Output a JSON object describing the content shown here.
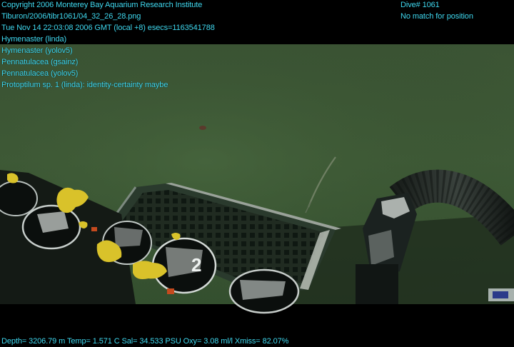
{
  "overlay": {
    "lines_left": [
      "Copyright 2006 Monterey Bay Aquarium Research Institute",
      "Tiburon/2006/tibr1061/04_32_26_28.png",
      "Tue Nov 14 22:03:08 2006 GMT (local +8)  esecs=1163541788",
      "Hymenaster (linda)",
      "Hymenaster (yolov5)",
      "Pennatulacea (gsainz)",
      "Pennatulacea (yolov5)",
      "Protoptilum sp. 1 (linda): identity-certainty maybe"
    ],
    "lines_right": [
      "Dive# 1061",
      "No match for position"
    ],
    "bottom": "Depth= 3206.79 m  Temp= 1.571 C  Sal= 34.533 PSU  Oxy= 3.08 ml/l  Xmiss= 82.07%"
  },
  "colors": {
    "overlay_text": "#3fd8ef",
    "seafloor": "#3e5a38"
  },
  "scene": {
    "canister_label": "2"
  }
}
